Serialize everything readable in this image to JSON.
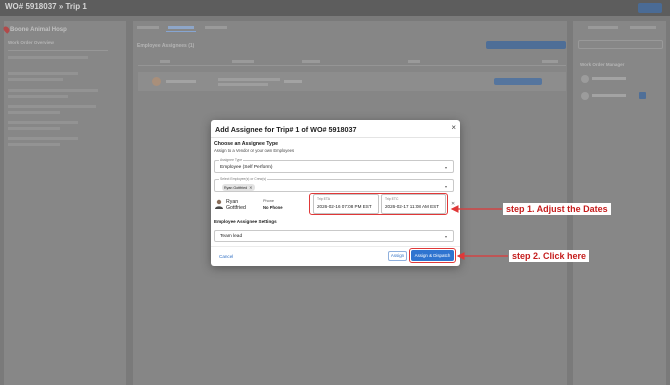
{
  "app": {
    "title": "WO# 5918037 » Trip 1",
    "location_name": "Boone Animal Hosp",
    "left_section_heading": "Work Order Overview",
    "center_section_label": "Employee Assignees (1)",
    "right_section_heading": "Work Order Manager"
  },
  "modal": {
    "title": "Add Assignee for Trip# 1 of WO# 5918037",
    "close_glyph": "×",
    "section_title": "Choose an Assignee Type",
    "section_subtitle": "Assign to a Vendor or your own Employees",
    "assignee_type": {
      "label": "Assignee Type",
      "value": "Employee (Self Perform)"
    },
    "employees": {
      "label": "Select Employee(s) or Crew(s)",
      "chips": [
        {
          "name": "Ryan Gottfried"
        }
      ]
    },
    "assignee": {
      "first_name": "Ryan",
      "last_name": "Gottfried",
      "phone_label": "Phone",
      "phone_value": "No Phone",
      "trip_eta_label": "Trip ETA",
      "trip_eta_value": "2026-02-16 07:08 PM EST",
      "trip_etc_label": "Trip ETC",
      "trip_etc_value": "2026-02-17 11:08 AM EST"
    },
    "settings_title": "Employee Assignee Settings",
    "settings_select_value": "Team lead",
    "buttons": {
      "cancel": "Cancel",
      "assign": "Assign",
      "assign_dispatch": "Assign & Dispatch"
    }
  },
  "annotations": {
    "step1": "step 1. Adjust the Dates",
    "step2": "step 2. Click here"
  },
  "colors": {
    "primary": "#2f74d0",
    "annotation": "#c51d1d"
  }
}
